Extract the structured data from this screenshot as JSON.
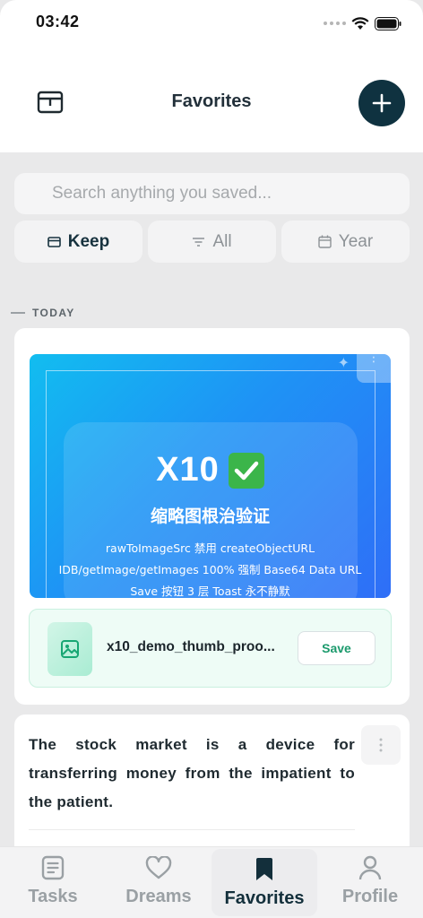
{
  "status_bar": {
    "time": "03:42"
  },
  "header": {
    "title": "Favorites"
  },
  "search": {
    "placeholder": "Search anything you saved..."
  },
  "filters": [
    {
      "label": "Keep",
      "icon": "card-icon",
      "active": true
    },
    {
      "label": "All",
      "icon": "filter-icon",
      "active": false
    },
    {
      "label": "Year",
      "icon": "calendar-icon",
      "active": false
    }
  ],
  "section": {
    "label": "TODAY"
  },
  "card1": {
    "thumbnail": {
      "title": "X10",
      "subtitle": "缩略图根治验证",
      "lines": [
        "rawToImageSrc 禁用 createObjectURL",
        "IDB/getImage/getImages 100% 强制 Base64 Data URL",
        "Save 按钮 3 层 Toast 永不静默"
      ]
    },
    "file_name": "x10_demo_thumb_proo...",
    "save_label": "Save"
  },
  "card2": {
    "quote": "The stock market is a device for transferring money from the impatient to the patient."
  },
  "tabs": [
    {
      "label": "Tasks",
      "icon": "list-icon",
      "active": false
    },
    {
      "label": "Dreams",
      "icon": "heart-icon",
      "active": false
    },
    {
      "label": "Favorites",
      "icon": "bookmark-icon",
      "active": true
    },
    {
      "label": "Profile",
      "icon": "user-icon",
      "active": false
    }
  ],
  "colors": {
    "accent": "#0f3240",
    "save_text": "#1b9a6c",
    "background": "#e9e9ea"
  }
}
